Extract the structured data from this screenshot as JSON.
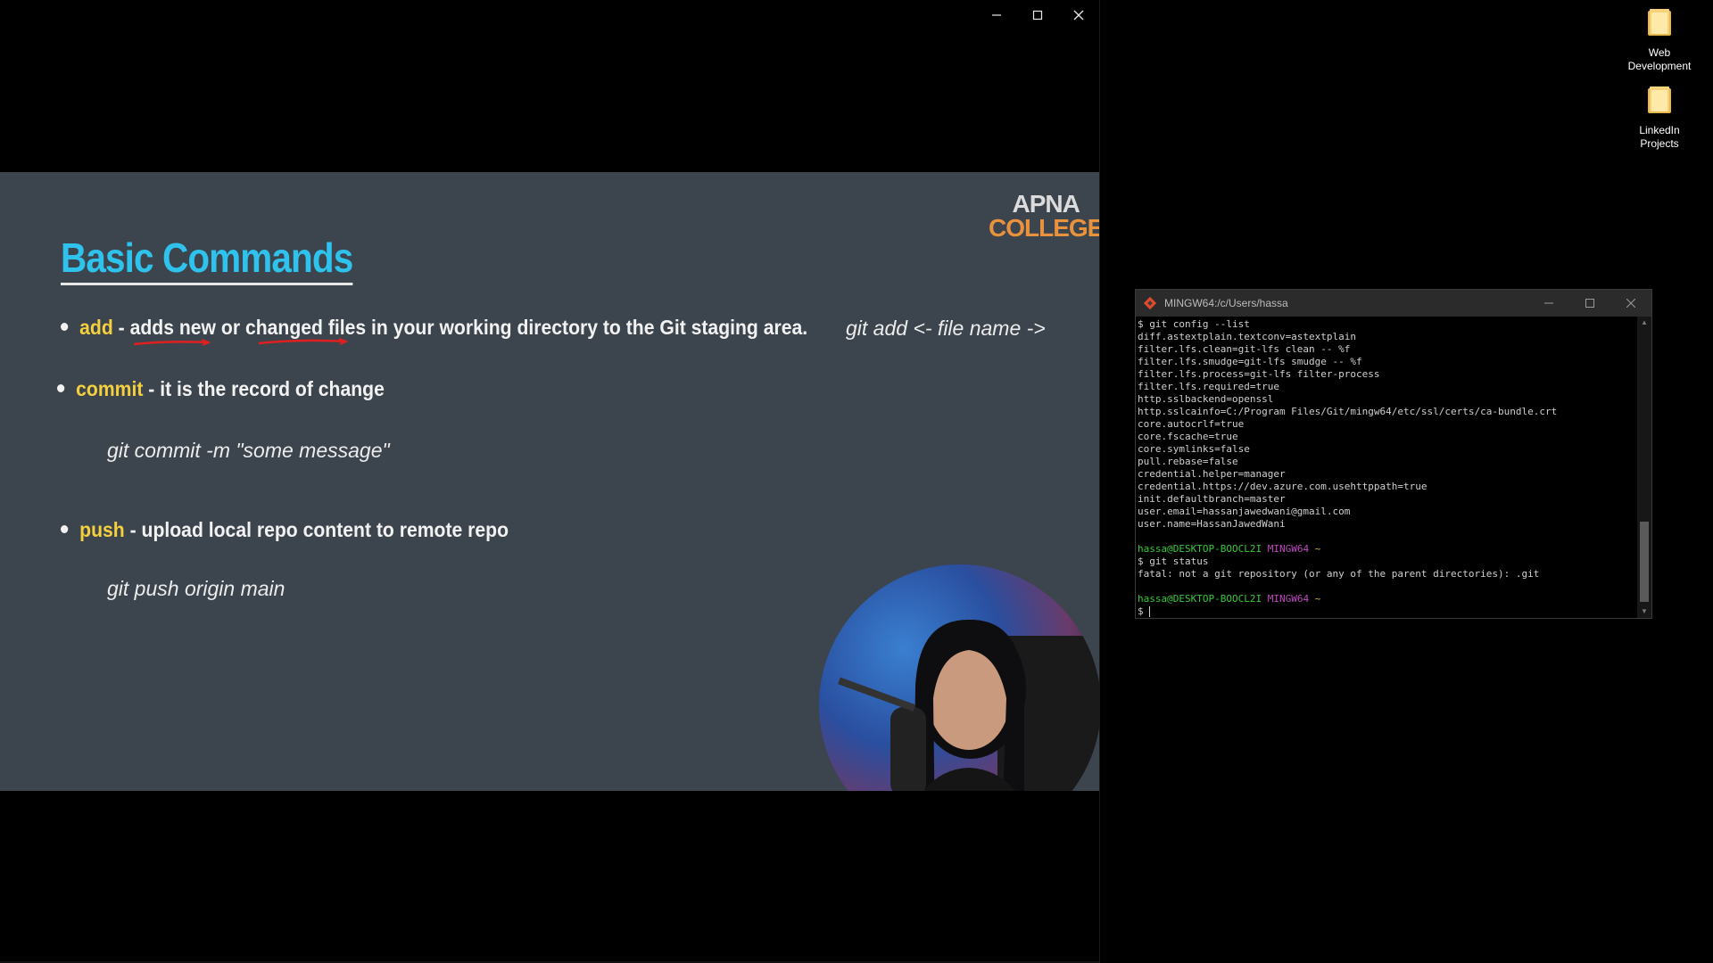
{
  "video": {
    "slide": {
      "logo_line1": "APNA",
      "logo_line2": "COLLEGE",
      "title": "Basic Commands",
      "bullets": [
        {
          "keyword": "add",
          "text_before": " - ",
          "text_hl1": "adds new",
          "text_mid": " or ",
          "text_hl2": "changed files",
          "text_after": " in your working directory to the Git staging area.",
          "command": "git add <- file name ->"
        },
        {
          "keyword": "commit",
          "text": " - it is the record of change",
          "command": "git commit -m \"some message\""
        },
        {
          "keyword": "push",
          "text": " - upload local repo content to remote repo",
          "command": "git push origin main"
        }
      ]
    }
  },
  "desktop": {
    "icons": [
      {
        "label_l1": "Web",
        "label_l2": "Development",
        "icon": "folder-icon"
      },
      {
        "label_l1": "LinkedIn",
        "label_l2": "Projects",
        "icon": "folder-icon"
      }
    ]
  },
  "terminal": {
    "title": "MINGW64:/c/Users/hassa",
    "lines": [
      "$ git config --list",
      "diff.astextplain.textconv=astextplain",
      "filter.lfs.clean=git-lfs clean -- %f",
      "filter.lfs.smudge=git-lfs smudge -- %f",
      "filter.lfs.process=git-lfs filter-process",
      "filter.lfs.required=true",
      "http.sslbackend=openssl",
      "http.sslcainfo=C:/Program Files/Git/mingw64/etc/ssl/certs/ca-bundle.crt",
      "core.autocrlf=true",
      "core.fscache=true",
      "core.symlinks=false",
      "pull.rebase=false",
      "credential.helper=manager",
      "credential.https://dev.azure.com.usehttppath=true",
      "init.defaultbranch=master",
      "user.email=hassanjawedwani@gmail.com",
      "user.name=HassanJawedWani"
    ],
    "prompt_user": "hassa@DESKTOP-BOOCL2I",
    "prompt_host": "MINGW64",
    "prompt_dir": "~",
    "cmd2": "$ git status",
    "error": "fatal: not a git repository (or any of the parent directories): .git",
    "last_prompt": "$ "
  }
}
